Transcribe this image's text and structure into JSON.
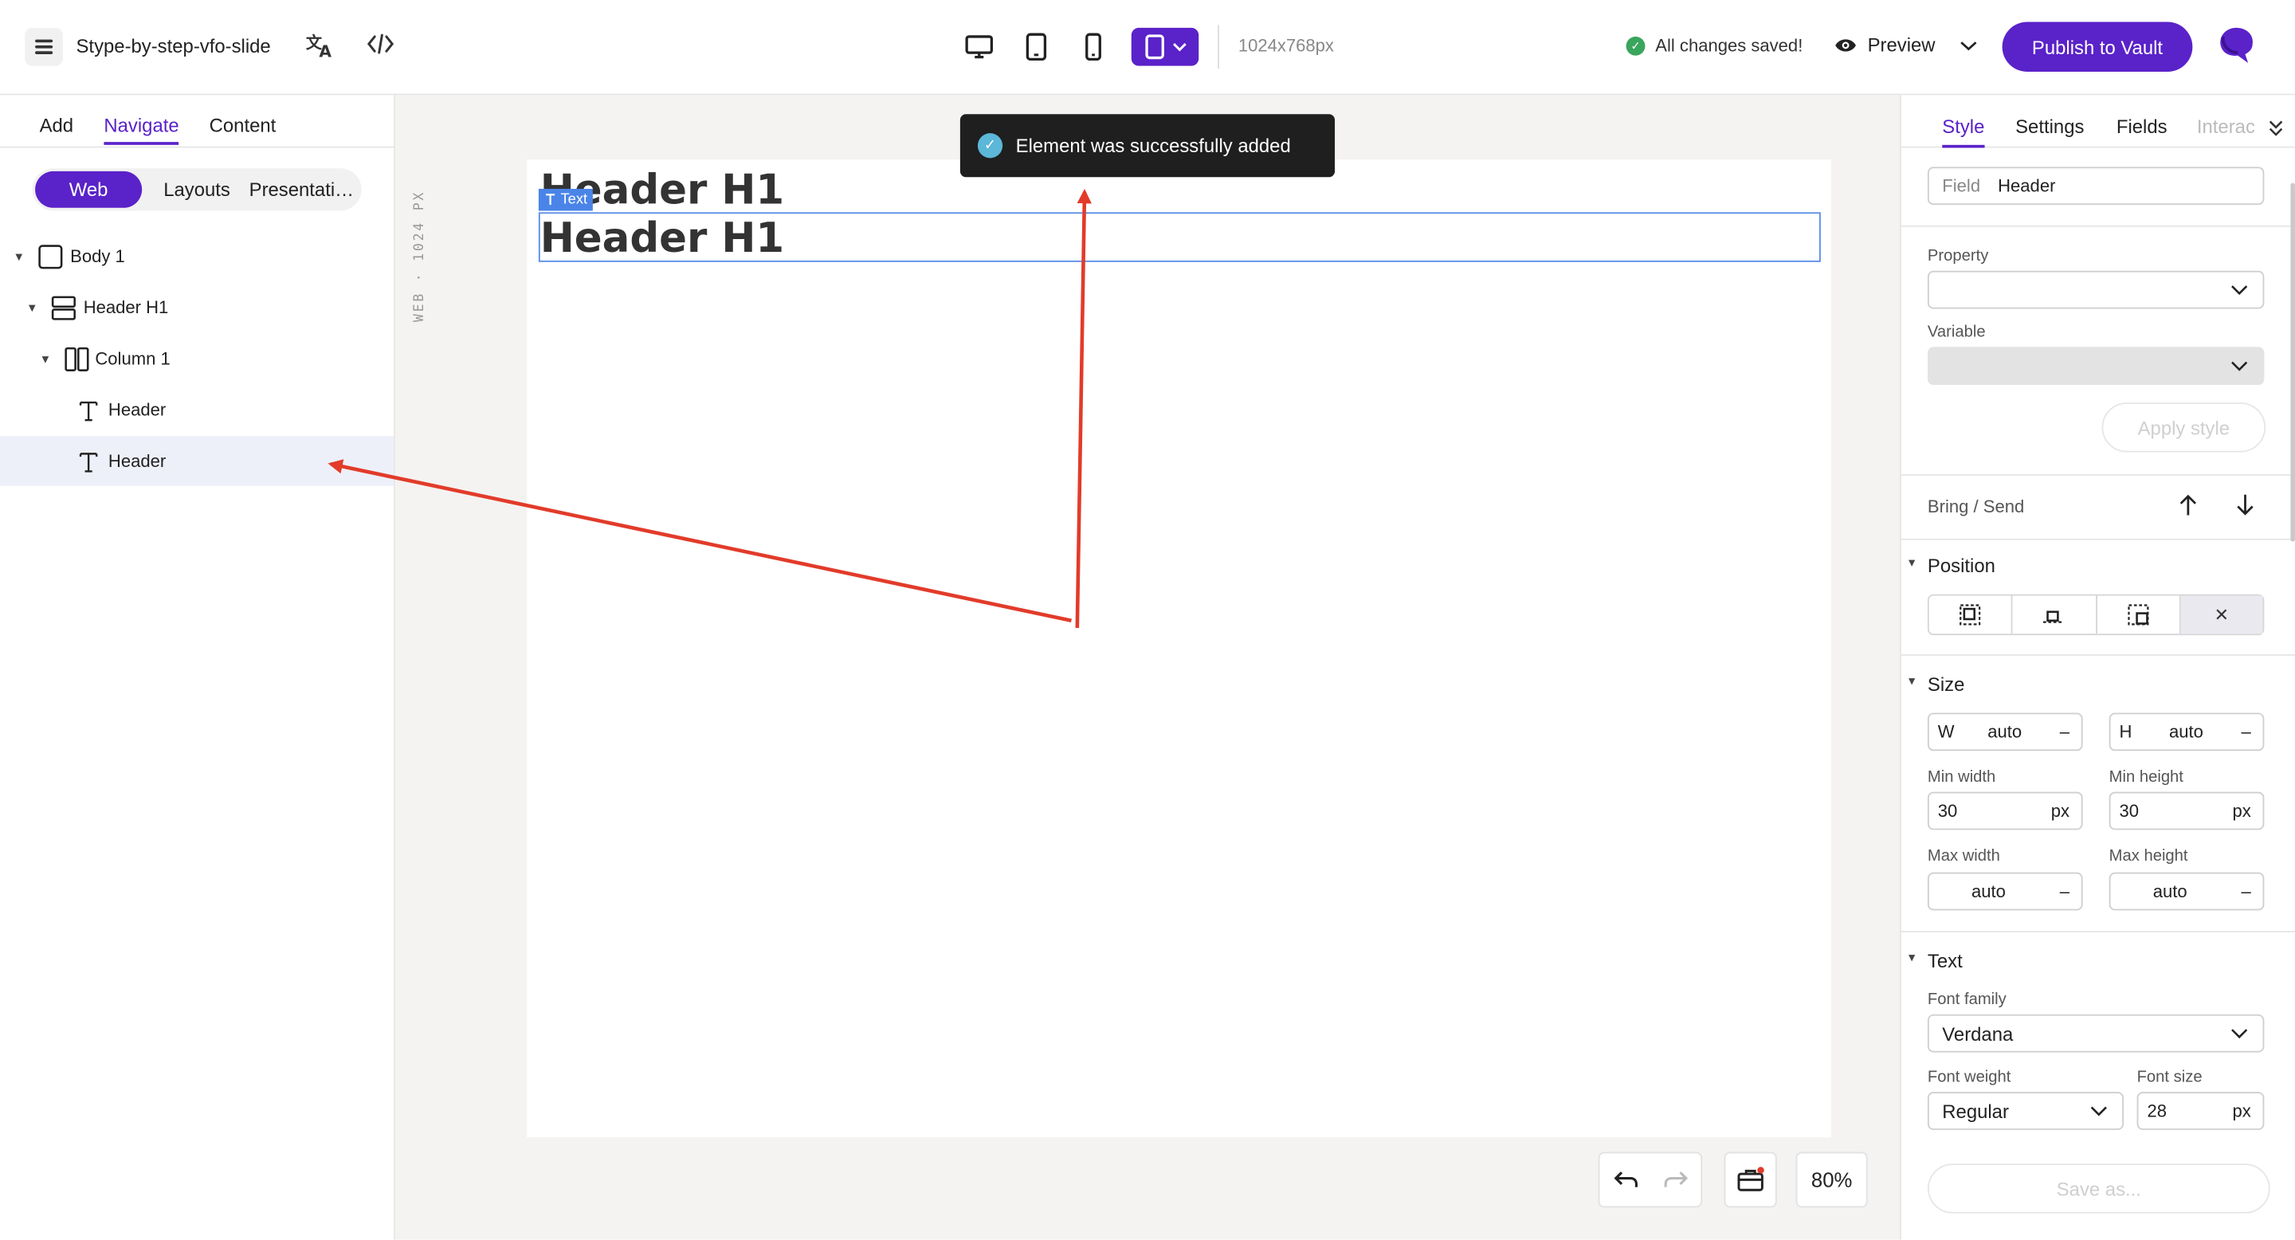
{
  "topbar": {
    "project_name": "Stype-by-step-vfo-slide",
    "translate_icon": "translate-icon",
    "code_icon": "code-icon",
    "resolution": "1024x768px",
    "saved_status": "All changes saved!",
    "preview_label": "Preview",
    "publish_label": "Publish to Vault",
    "accent_color": "#5a22c9"
  },
  "left_panel": {
    "tabs": [
      {
        "label": "Add"
      },
      {
        "label": "Navigate",
        "active": true
      },
      {
        "label": "Content"
      }
    ],
    "segments": [
      {
        "label": "Web",
        "active": true
      },
      {
        "label": "Layouts"
      },
      {
        "label": "Presentati…"
      }
    ],
    "tree": [
      {
        "label": "Body 1",
        "icon": "body-icon",
        "expanded": true
      },
      {
        "label": "Header H1",
        "icon": "row-icon",
        "expanded": true
      },
      {
        "label": "Column 1",
        "icon": "column-icon",
        "expanded": true
      },
      {
        "label": "Header",
        "icon": "text-icon"
      },
      {
        "label": "Header",
        "icon": "text-icon",
        "selected": true
      }
    ]
  },
  "canvas": {
    "ruler_label": "WEB · 1024 PX",
    "heading_1": "Header H1",
    "heading_2": "Header H1",
    "element_tag": "Text",
    "toast": "Element was successfully added",
    "zoom": "80%"
  },
  "right_panel": {
    "tabs": [
      {
        "label": "Style",
        "active": true
      },
      {
        "label": "Settings"
      },
      {
        "label": "Fields"
      },
      {
        "label": "Interac"
      }
    ],
    "field_label": "Field",
    "field_value": "Header",
    "property_label": "Property",
    "variable_label": "Variable",
    "apply_style_label": "Apply style",
    "bring_send_label": "Bring / Send",
    "position_label": "Position",
    "size_label": "Size",
    "width": {
      "prefix": "W",
      "value": "auto",
      "unit": "–"
    },
    "height": {
      "prefix": "H",
      "value": "auto",
      "unit": "–"
    },
    "min_width": {
      "label": "Min width",
      "value": "30",
      "unit": "px"
    },
    "min_height": {
      "label": "Min height",
      "value": "30",
      "unit": "px"
    },
    "max_width": {
      "label": "Max width",
      "value": "auto",
      "unit": "–"
    },
    "max_height": {
      "label": "Max height",
      "value": "auto",
      "unit": "–"
    },
    "text_label": "Text",
    "font_family_label": "Font family",
    "font_family_value": "Verdana",
    "font_weight_label": "Font weight",
    "font_weight_value": "Regular",
    "font_size_label": "Font size",
    "font_size_value": "28",
    "font_size_unit": "px",
    "save_as_label": "Save as..."
  },
  "annotation_color": "#e23b2a"
}
